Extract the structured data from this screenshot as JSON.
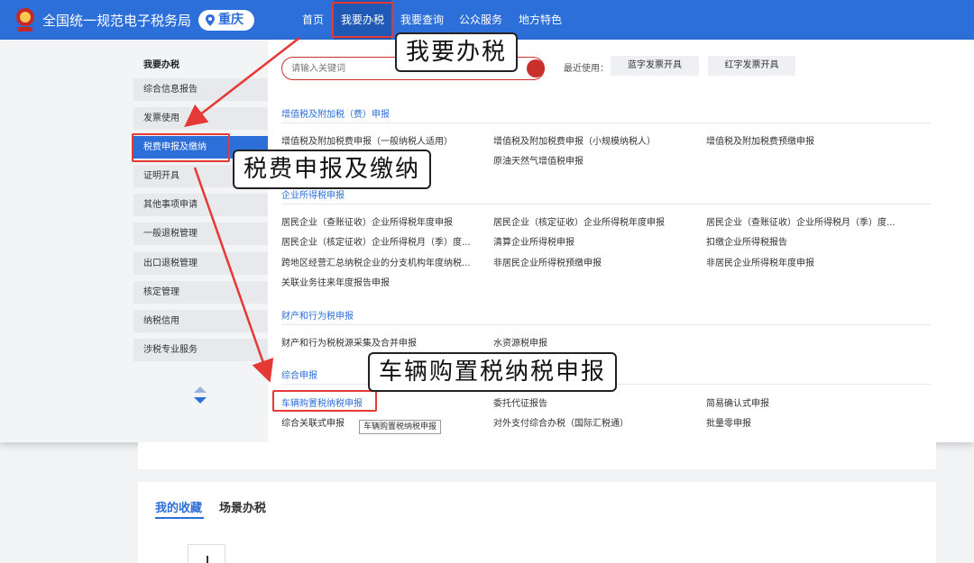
{
  "header": {
    "site_title": "全国统一规范电子税务局",
    "region": "重庆",
    "nav": [
      "首页",
      "我要办税",
      "我要查询",
      "公众服务",
      "地方特色"
    ]
  },
  "sidebar": {
    "title": "我要办税",
    "items": [
      "综合信息报告",
      "发票使用",
      "税费申报及缴纳",
      "证明开具",
      "其他事项申请",
      "一般退税管理",
      "出口退税管理",
      "核定管理",
      "纳税信用",
      "涉税专业服务"
    ],
    "active_index": 2
  },
  "search": {
    "placeholder": "请输入关键词",
    "recent_label": "最近使用：",
    "recent": [
      "蓝字发票开具",
      "红字发票开具"
    ]
  },
  "sections": [
    {
      "title": "增值税及附加税（费）申报",
      "links": [
        "增值税及附加税费申报（一般纳税人适用）",
        "增值税及附加税费申报（小规模纳税人）",
        "增值税及附加税费预缴申报",
        "",
        "原油天然气增值税申报"
      ]
    },
    {
      "title": "企业所得税申报",
      "links": [
        "居民企业（查账征收）企业所得税年度申报",
        "居民企业（核定征收）企业所得税年度申报",
        "居民企业（查账征收）企业所得税月（季）度...",
        "居民企业（核定征收）企业所得税月（季）度...",
        "清算企业所得税申报",
        "扣缴企业所得税报告",
        "跨地区经营汇总纳税企业的分支机构年度纳税...",
        "非居民企业所得税预缴申报",
        "非居民企业所得税年度申报",
        "关联业务往来年度报告申报"
      ]
    },
    {
      "title": "财产和行为税申报",
      "links": [
        "财产和行为税税源采集及合并申报",
        "水资源税申报"
      ]
    },
    {
      "title": "综合申报",
      "links": [
        "车辆购置税纳税申报",
        "委托代征报告",
        "简易确认式申报",
        "综合关联式申报",
        "对外支付综合办税（国际汇税通）",
        "批量零申报"
      ]
    }
  ],
  "tooltip": "车辆购置税纳税申报",
  "callouts": [
    "我要办税",
    "税费申报及缴纳",
    "车辆购置税纳税申报"
  ],
  "lower": {
    "tabs": [
      "我的收藏",
      "场景办税"
    ]
  },
  "colors": {
    "header_blue": "#2d6fd9",
    "annotation_red": "#e53935",
    "section_blue": "#2d6fd9"
  }
}
